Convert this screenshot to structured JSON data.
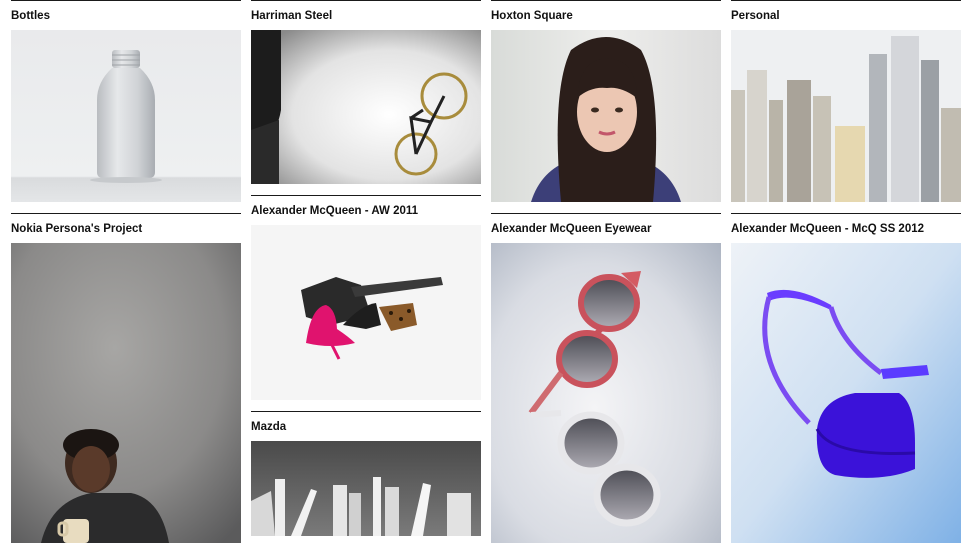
{
  "projects": [
    {
      "title": "Bottles",
      "image": "white-bottle-photo"
    },
    {
      "title": "Nokia Persona's Project",
      "image": "portrait-woman-holding-mug-photo"
    },
    {
      "title": "Harriman Steel",
      "image": "bicycle-in-studio-photo"
    },
    {
      "title": "Alexander McQueen - AW 2011",
      "image": "pink-shoe-and-clutch-photo"
    },
    {
      "title": "Mazda",
      "image": "white-architectural-model-photo"
    },
    {
      "title": "Hoxton Square",
      "image": "portrait-woman-with-bangs-photo"
    },
    {
      "title": "Alexander McQueen Eyewear",
      "image": "sunglasses-photo"
    },
    {
      "title": "Personal",
      "image": "city-skyscrapers-photo"
    },
    {
      "title": "Alexander McQueen - McQ SS 2012",
      "image": "blue-handbag-photo"
    }
  ]
}
